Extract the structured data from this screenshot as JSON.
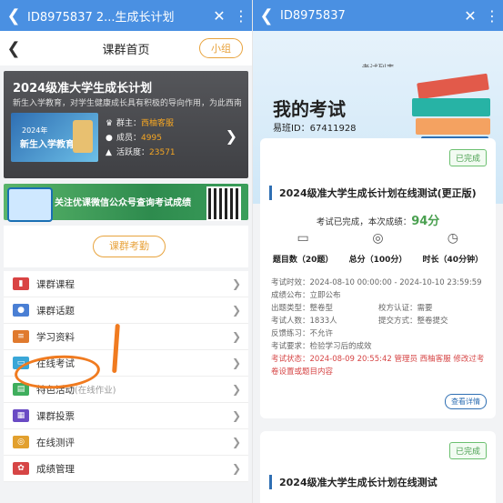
{
  "left": {
    "title_bar": {
      "back": "❮",
      "title": "ID8975837 2...生成长计划",
      "close": "✕",
      "menu": "⋮"
    },
    "header": {
      "back": "❮",
      "title": "课群首页",
      "group_button": "小组"
    },
    "banner": {
      "title": "2024级准大学生成长计划",
      "desc": "新生入学教育，对学生健康成长具有积极的导向作用，为此西南...",
      "thumb_year": "2024年",
      "thumb_title": "新生入学教育",
      "owner_label": "群主：",
      "owner_value": "西柚客服",
      "members_label": "成员：",
      "members_value": "4995",
      "activity_label": "活跃度：",
      "activity_value": "23571"
    },
    "ad_text": "关注优课微信公众号查询考试成绩",
    "exam_button": "课群考勤",
    "menu": [
      {
        "label": "课群课程",
        "sub": "",
        "icon": "course-icon",
        "color": "#d94343"
      },
      {
        "label": "课群话题",
        "sub": "",
        "icon": "chat-icon",
        "color": "#4a7fd4"
      },
      {
        "label": "学习资料",
        "sub": "",
        "icon": "files-icon",
        "color": "#e07a2e"
      },
      {
        "label": "在线考试",
        "sub": "",
        "icon": "exam-icon",
        "color": "#3aa7d8"
      },
      {
        "label": "特色活动",
        "sub": "(在线作业)",
        "icon": "clipboard-icon",
        "color": "#3fae5d"
      },
      {
        "label": "课群投票",
        "sub": "",
        "icon": "vote-icon",
        "color": "#6a4bc4"
      },
      {
        "label": "在线测评",
        "sub": "",
        "icon": "target-icon",
        "color": "#e2a02e"
      },
      {
        "label": "成绩管理",
        "sub": "",
        "icon": "ribbon-icon",
        "color": "#d64545"
      }
    ]
  },
  "right": {
    "title_bar": {
      "back": "❮",
      "title": "ID8975837",
      "close": "✕",
      "menu": "⋮"
    },
    "partial_header": "考试列表",
    "title": "我的考试",
    "yiban_id": "易班ID：67411928",
    "card1": {
      "badge": "已完成",
      "title": "2024级准大学生成长计划在线测试(更正版)",
      "result_prefix": "考试已完成，本次成绩：",
      "score": "94分",
      "metrics": [
        {
          "icon": "doc-icon",
          "glyph": "▭",
          "text": "题目数（20题）"
        },
        {
          "icon": "coins-icon",
          "glyph": "◎",
          "text": "总分（100分）"
        },
        {
          "icon": "clock-icon",
          "glyph": "◷",
          "text": "时长（40分钟）"
        }
      ],
      "time": "考试时效：2024-08-10 00:00:00 - 2024-10-10 23:59:59",
      "publish": "成绩公布：立即公布",
      "type": "出题类型：整卷型",
      "auth": "校方认证：需要",
      "people": "考试人数：1833人",
      "submit": "提交方式：整卷提交",
      "feedback": "反馈练习：不允许",
      "requirement": "考试要求：检验学习后的成效",
      "status": "考试状态：2024-08-09 20:55:42 管理员 西柚客服 修改过考卷设置或题目内容",
      "detail_button": "查看详情"
    },
    "card2": {
      "badge": "已完成",
      "title": "2024级准大学生成长计划在线测试"
    }
  }
}
